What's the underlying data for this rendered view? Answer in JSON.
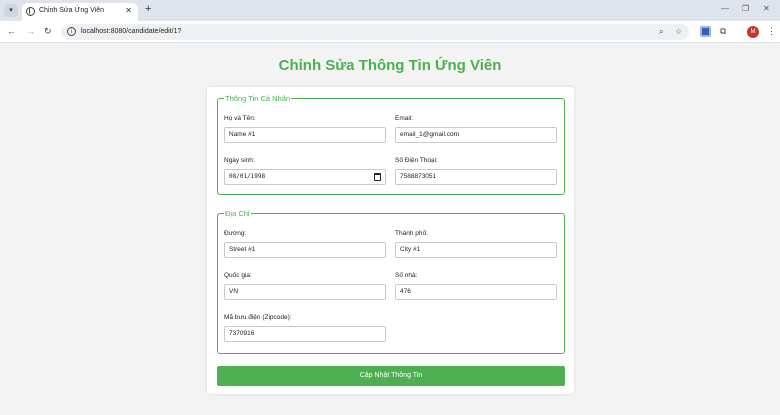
{
  "browser": {
    "tab_title": "Chỉnh Sửa Ứng Viên",
    "url": "localhost:8080/candidate/edit/1?",
    "profile_initial": "M"
  },
  "page": {
    "title": "Chỉnh Sửa Thông Tin Ứng Viên"
  },
  "personal": {
    "legend": "Thông Tin Cá Nhân",
    "fullname": {
      "label": "Họ và Tên:",
      "value": "Name #1"
    },
    "email": {
      "label": "Email:",
      "value": "email_1@gmail.com"
    },
    "dob": {
      "label": "Ngày sinh:",
      "value": "08/01/1998"
    },
    "phone": {
      "label": "Số Điện Thoại:",
      "value": "7588873051"
    }
  },
  "address": {
    "legend": "Địa Chỉ",
    "street": {
      "label": "Đường:",
      "value": "Street #1"
    },
    "city": {
      "label": "Thành phố:",
      "value": "City #1"
    },
    "country": {
      "label": "Quốc gia:",
      "value": "VN"
    },
    "number": {
      "label": "Số nhà:",
      "value": "476"
    },
    "zipcode": {
      "label": "Mã bưu điện (Zipcode):",
      "value": "7370916"
    }
  },
  "submit_label": "Cập Nhật Thông Tin",
  "colors": {
    "accent": "#4caf50"
  }
}
